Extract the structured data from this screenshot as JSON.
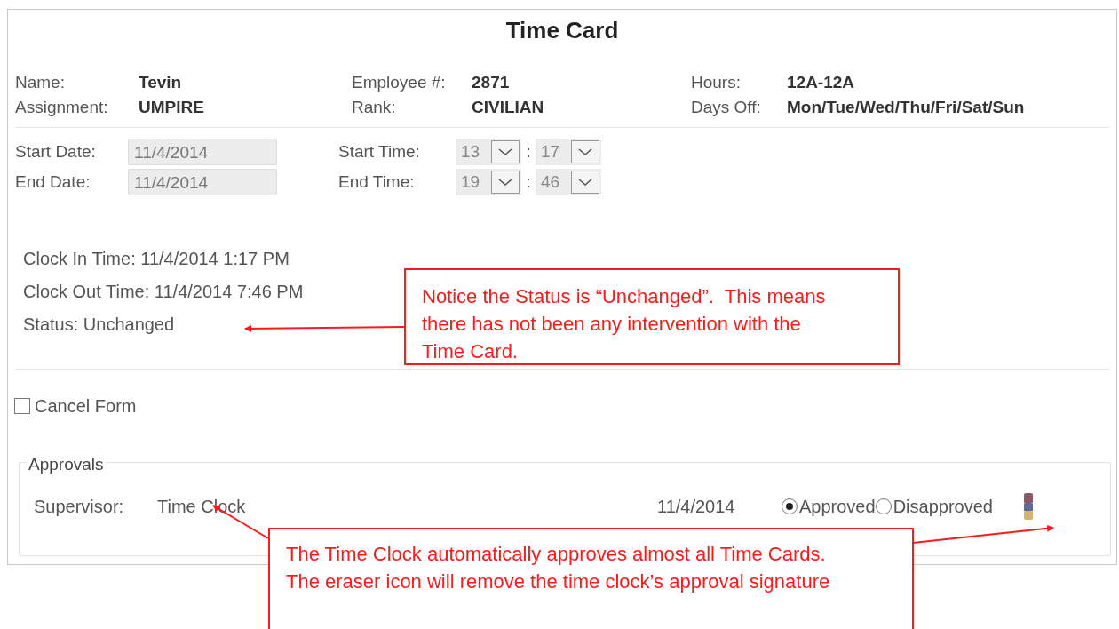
{
  "title": "Time Card",
  "info": [
    {
      "label": "Name:",
      "value": "Tevin"
    },
    {
      "label": "Employee #:",
      "value": "2871"
    },
    {
      "label": "Hours:",
      "value": "12A-12A"
    },
    {
      "label": "Assignment:",
      "value": "UMPIRE"
    },
    {
      "label": "Rank:",
      "value": "CIVILIAN"
    },
    {
      "label": "Days Off:",
      "value": "Mon/Tue/Wed/Thu/Fri/Sat/Sun"
    }
  ],
  "dates": [
    {
      "label": "Start Date:",
      "value": "11/4/2014",
      "time_label": "Start Time:",
      "hour": "13",
      "minute": "17"
    },
    {
      "label": "End Date:",
      "value": "11/4/2014",
      "time_label": "End Time:",
      "hour": "19",
      "minute": "46"
    }
  ],
  "clock_lines": [
    "Clock In Time: 11/4/2014 1:17 PM",
    "Clock Out Time: 11/4/2014 7:46 PM",
    "Status: Unchanged"
  ],
  "cancel_form": {
    "label": "Cancel Form",
    "checked": false
  },
  "approvals": {
    "legend": "Approvals",
    "supervisor_label": "Supervisor:",
    "supervisor": "Time Clock",
    "date": "11/4/2014",
    "options": [
      {
        "label": "Approved",
        "selected": true
      },
      {
        "label": "Disapproved",
        "selected": false
      }
    ]
  },
  "annotations": [
    {
      "text": "Notice the Status is “Unchanged”.  This means there has not been any intervention with the Time Card."
    },
    {
      "text": "The Time Clock automatically approves almost all Time Cards.  The eraser icon will remove the time clock’s approval signature"
    }
  ]
}
